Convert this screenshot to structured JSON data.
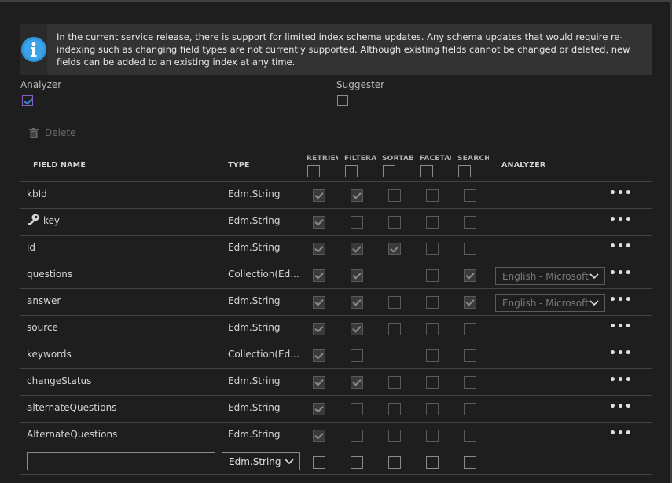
{
  "info": {
    "message": "In the current service release, there is support for limited index schema updates. Any schema updates that would require re-indexing such as changing field types are not currently supported. Although existing fields cannot be changed or deleted, new fields can be added to an existing index at any time."
  },
  "options": {
    "analyzer_label": "Analyzer",
    "analyzer_checked": true,
    "suggester_label": "Suggester",
    "suggester_checked": false
  },
  "toolbar": {
    "delete_label": "Delete"
  },
  "columns": {
    "field_name": "FIELD NAME",
    "type": "TYPE",
    "retrievable": "RETRIEV.",
    "filterable": "FILTERAB",
    "sortable": "SORTAB",
    "facetable": "FACETAB",
    "searchable": "SEARCH.",
    "analyzer": "ANALYZER"
  },
  "rows": [
    {
      "name": "kbId",
      "type": "Edm.String",
      "key": false,
      "retrievable": true,
      "filterable": true,
      "sortable": false,
      "facetable": false,
      "searchable": false,
      "analyzer": "",
      "more": "•••"
    },
    {
      "name": "key",
      "type": "Edm.String",
      "key": true,
      "retrievable": true,
      "filterable": false,
      "sortable": false,
      "facetable": false,
      "searchable": false,
      "analyzer": "",
      "more": "•••"
    },
    {
      "name": "id",
      "type": "Edm.String",
      "key": false,
      "retrievable": true,
      "filterable": true,
      "sortable": true,
      "facetable": false,
      "searchable": false,
      "analyzer": "",
      "more": "•••"
    },
    {
      "name": "questions",
      "type": "Collection(Ed...",
      "key": false,
      "retrievable": true,
      "filterable": true,
      "sortable": null,
      "facetable": false,
      "searchable": true,
      "analyzer": "English - Microsoft",
      "more": "•••"
    },
    {
      "name": "answer",
      "type": "Edm.String",
      "key": false,
      "retrievable": true,
      "filterable": true,
      "sortable": false,
      "facetable": false,
      "searchable": true,
      "analyzer": "English - Microsoft",
      "more": "•••"
    },
    {
      "name": "source",
      "type": "Edm.String",
      "key": false,
      "retrievable": true,
      "filterable": true,
      "sortable": false,
      "facetable": false,
      "searchable": false,
      "analyzer": "",
      "more": "•••"
    },
    {
      "name": "keywords",
      "type": "Collection(Ed...",
      "key": false,
      "retrievable": true,
      "filterable": false,
      "sortable": null,
      "facetable": false,
      "searchable": false,
      "analyzer": "",
      "more": "•••"
    },
    {
      "name": "changeStatus",
      "type": "Edm.String",
      "key": false,
      "retrievable": true,
      "filterable": true,
      "sortable": false,
      "facetable": false,
      "searchable": false,
      "analyzer": "",
      "more": "•••"
    },
    {
      "name": "alternateQuestions",
      "type": "Edm.String",
      "key": false,
      "retrievable": true,
      "filterable": false,
      "sortable": false,
      "facetable": false,
      "searchable": false,
      "analyzer": "",
      "more": "•••"
    },
    {
      "name": "AlternateQuestions",
      "type": "Edm.String",
      "key": false,
      "retrievable": true,
      "filterable": false,
      "sortable": false,
      "facetable": false,
      "searchable": false,
      "analyzer": "",
      "more": "•••"
    }
  ],
  "new_field": {
    "name_value": "",
    "type_value": "Edm.String"
  },
  "colors": {
    "accent_check": "#3b8ad9",
    "info_icon": "#2f95dc"
  }
}
